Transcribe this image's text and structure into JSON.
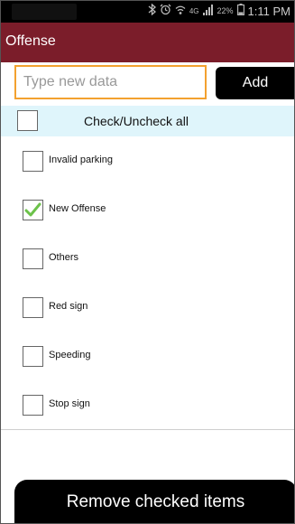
{
  "status_bar": {
    "battery_percent": "22%",
    "network_label": "4G",
    "time": "1:11 PM"
  },
  "header": {
    "title": "Offense"
  },
  "entry": {
    "placeholder": "Type new data",
    "add_label": "Add"
  },
  "check_all": {
    "label": "Check/Uncheck all",
    "checked": false
  },
  "items": [
    {
      "label": "Invalid parking",
      "checked": false
    },
    {
      "label": "New Offense",
      "checked": true
    },
    {
      "label": "Others",
      "checked": false
    },
    {
      "label": "Red sign",
      "checked": false
    },
    {
      "label": "Speeding",
      "checked": false
    },
    {
      "label": "Stop sign",
      "checked": false
    }
  ],
  "footer": {
    "remove_label": "Remove checked items"
  },
  "colors": {
    "title_bar": "#7b1d2a",
    "input_border": "#f3a12f",
    "check_all_bg": "#dff5fb",
    "check_mark": "#6cc24a"
  }
}
